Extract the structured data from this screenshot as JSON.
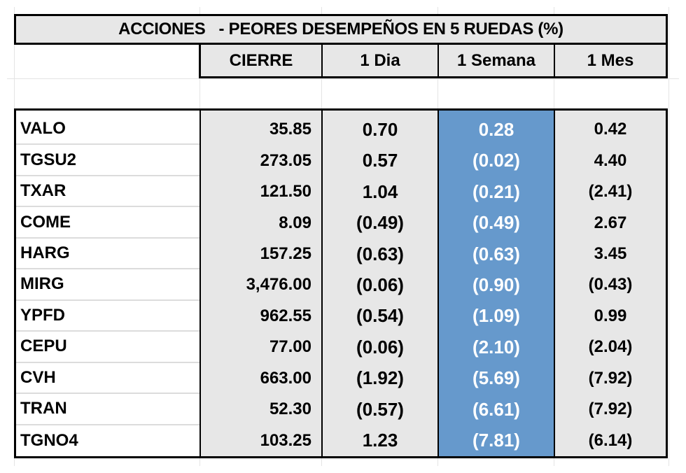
{
  "title": "ACCIONES   - PEORES DESEMPEÑOS EN 5 RUEDAS (%)",
  "columns": [
    "CIERRE",
    "1 Dia",
    "1 Semana",
    "1 Mes"
  ],
  "highlight_color": "#6699cc",
  "rows": [
    {
      "ticker": "VALO",
      "cierre": "35.85",
      "dia": "0.70",
      "semana": "0.28",
      "mes": "0.42"
    },
    {
      "ticker": "TGSU2",
      "cierre": "273.05",
      "dia": "0.57",
      "semana": "(0.02)",
      "mes": "4.40"
    },
    {
      "ticker": "TXAR",
      "cierre": "121.50",
      "dia": "1.04",
      "semana": "(0.21)",
      "mes": "(2.41)"
    },
    {
      "ticker": "COME",
      "cierre": "8.09",
      "dia": "(0.49)",
      "semana": "(0.49)",
      "mes": "2.67"
    },
    {
      "ticker": "HARG",
      "cierre": "157.25",
      "dia": "(0.63)",
      "semana": "(0.63)",
      "mes": "3.45"
    },
    {
      "ticker": "MIRG",
      "cierre": "3,476.00",
      "dia": "(0.06)",
      "semana": "(0.90)",
      "mes": "(0.43)"
    },
    {
      "ticker": "YPFD",
      "cierre": "962.55",
      "dia": "(0.54)",
      "semana": "(1.09)",
      "mes": "0.99"
    },
    {
      "ticker": "CEPU",
      "cierre": "77.00",
      "dia": "(0.06)",
      "semana": "(2.10)",
      "mes": "(2.04)"
    },
    {
      "ticker": "CVH",
      "cierre": "663.00",
      "dia": "(1.92)",
      "semana": "(5.69)",
      "mes": "(7.92)"
    },
    {
      "ticker": "TRAN",
      "cierre": "52.30",
      "dia": "(0.57)",
      "semana": "(6.61)",
      "mes": "(7.92)"
    },
    {
      "ticker": "TGNO4",
      "cierre": "103.25",
      "dia": "1.23",
      "semana": "(7.81)",
      "mes": "(6.14)"
    }
  ]
}
